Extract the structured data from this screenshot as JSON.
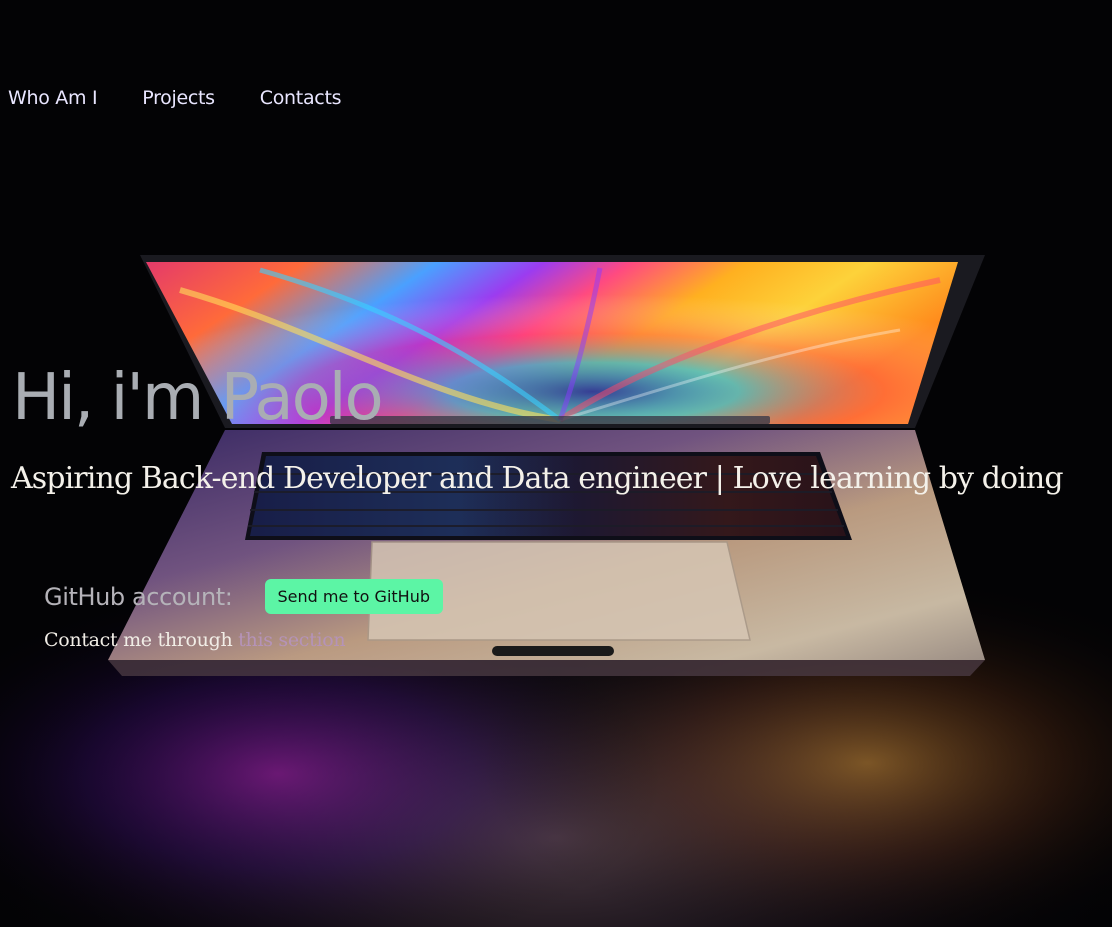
{
  "nav": {
    "items": [
      {
        "label": "Who Am I"
      },
      {
        "label": "Projects"
      },
      {
        "label": "Contacts"
      }
    ]
  },
  "hero": {
    "title": "Hi, i'm Paolo",
    "subtitle": "Aspiring Back-end Developer and Data engineer | Love learning by doing"
  },
  "github": {
    "label": "GitHub account:",
    "button_label": "Send me to GitHub"
  },
  "contact": {
    "prefix": "Contact me through ",
    "link_text": "this section"
  },
  "colors": {
    "button_bg": "#5cf5a5",
    "link": "#b593b8",
    "nav_text": "#e9e6ff",
    "title_text": "#a9adb3"
  }
}
